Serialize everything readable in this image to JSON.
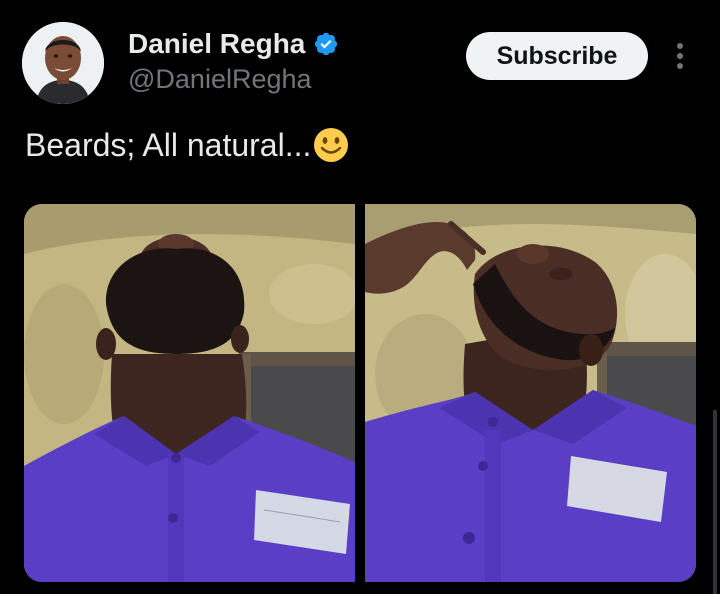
{
  "author": {
    "name": "Daniel Regha",
    "handle": "@DanielRegha",
    "verified_icon": "verified-badge-icon",
    "avatar_icon": "profile-avatar"
  },
  "actions": {
    "subscribe_label": "Subscribe",
    "more_icon": "more-vertical-icon"
  },
  "tweet": {
    "text": "Beards; All natural...",
    "emoji_icon": "slightly-smiling-face-emoji"
  },
  "media": {
    "count": 2,
    "items": [
      {
        "icon": "photo-beard-front"
      },
      {
        "icon": "photo-beard-side"
      }
    ]
  },
  "colors": {
    "background": "#000000",
    "primary_text": "#e7e9ea",
    "secondary_text": "#71767b",
    "verified_blue": "#1d9bf0",
    "subscribe_bg": "#eff3f4",
    "subscribe_text": "#0f1419",
    "shirt_purple": "#5a3fc6"
  }
}
